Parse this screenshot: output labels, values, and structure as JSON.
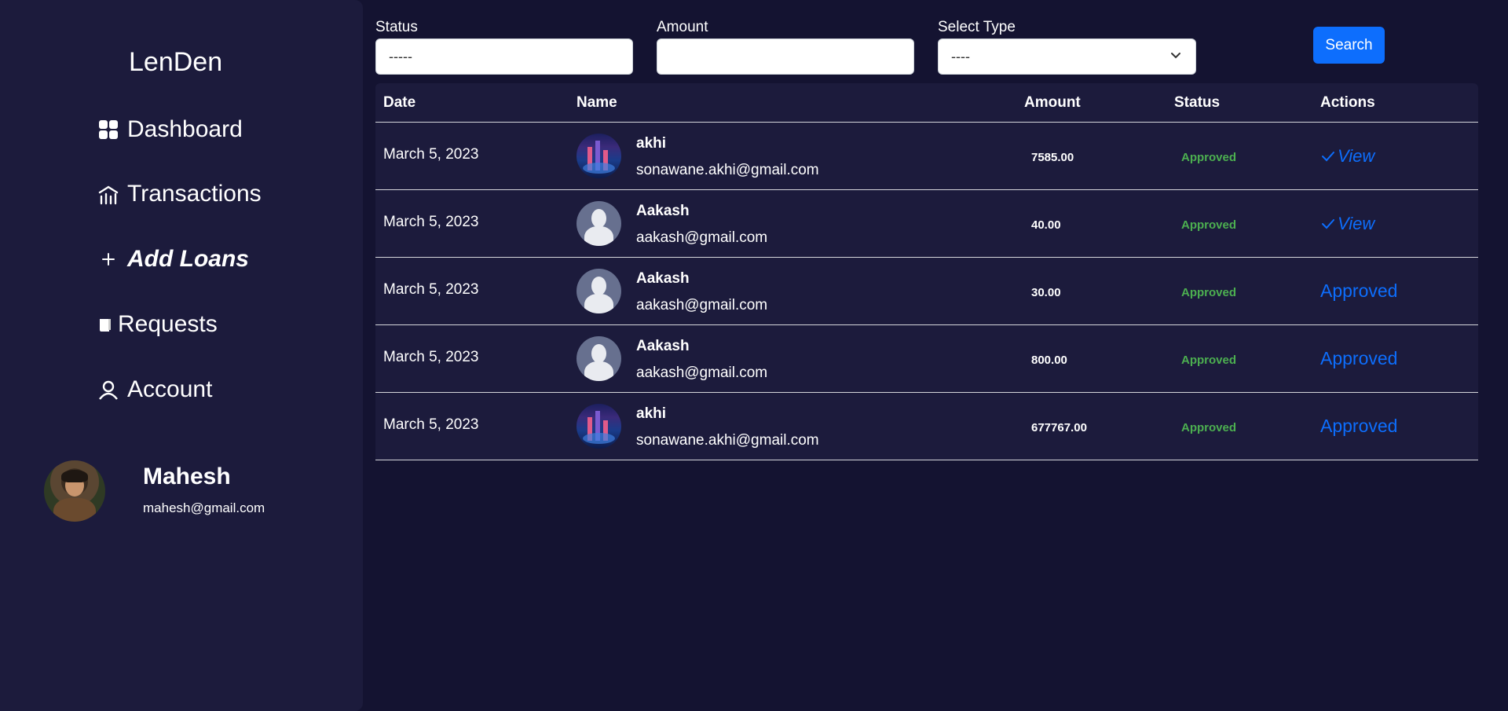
{
  "sidebar": {
    "brand": "LenDen",
    "items": [
      {
        "label": "Dashboard",
        "icon": "dashboard-grid-icon"
      },
      {
        "label": "Transactions",
        "icon": "transactions-icon"
      },
      {
        "label": "Add Loans",
        "icon": "plus-icon"
      },
      {
        "label": "Requests",
        "icon": "receipt-icon"
      },
      {
        "label": "Account",
        "icon": "user-icon"
      }
    ],
    "profile": {
      "name": "Mahesh",
      "email": "mahesh@gmail.com"
    }
  },
  "filters": {
    "status": {
      "label": "Status",
      "value": "-----"
    },
    "amount": {
      "label": "Amount",
      "value": ""
    },
    "type": {
      "label": "Select Type",
      "value": "----"
    },
    "search_label": "Search"
  },
  "table": {
    "headers": [
      "Date",
      "Name",
      "Amount",
      "Status",
      "Actions"
    ],
    "rows": [
      {
        "date": "March 5, 2023",
        "name": "akhi",
        "email": "sonawane.akhi@gmail.com",
        "amount": "7585.00",
        "status": "Approved",
        "action": "View",
        "avatar": "city"
      },
      {
        "date": "March 5, 2023",
        "name": "Aakash",
        "email": "aakash@gmail.com",
        "amount": "40.00",
        "status": "Approved",
        "action": "View",
        "avatar": "default"
      },
      {
        "date": "March 5, 2023",
        "name": "Aakash",
        "email": "aakash@gmail.com",
        "amount": "30.00",
        "status": "Approved",
        "action": "Approved",
        "avatar": "default"
      },
      {
        "date": "March 5, 2023",
        "name": "Aakash",
        "email": "aakash@gmail.com",
        "amount": "800.00",
        "status": "Approved",
        "action": "Approved",
        "avatar": "default"
      },
      {
        "date": "March 5, 2023",
        "name": "akhi",
        "email": "sonawane.akhi@gmail.com",
        "amount": "677767.00",
        "status": "Approved",
        "action": "Approved",
        "avatar": "city"
      }
    ]
  },
  "colors": {
    "background": "#141331",
    "sidebar": "#1c1b3c",
    "accent": "#0d6efd",
    "approved": "#4caf50"
  }
}
